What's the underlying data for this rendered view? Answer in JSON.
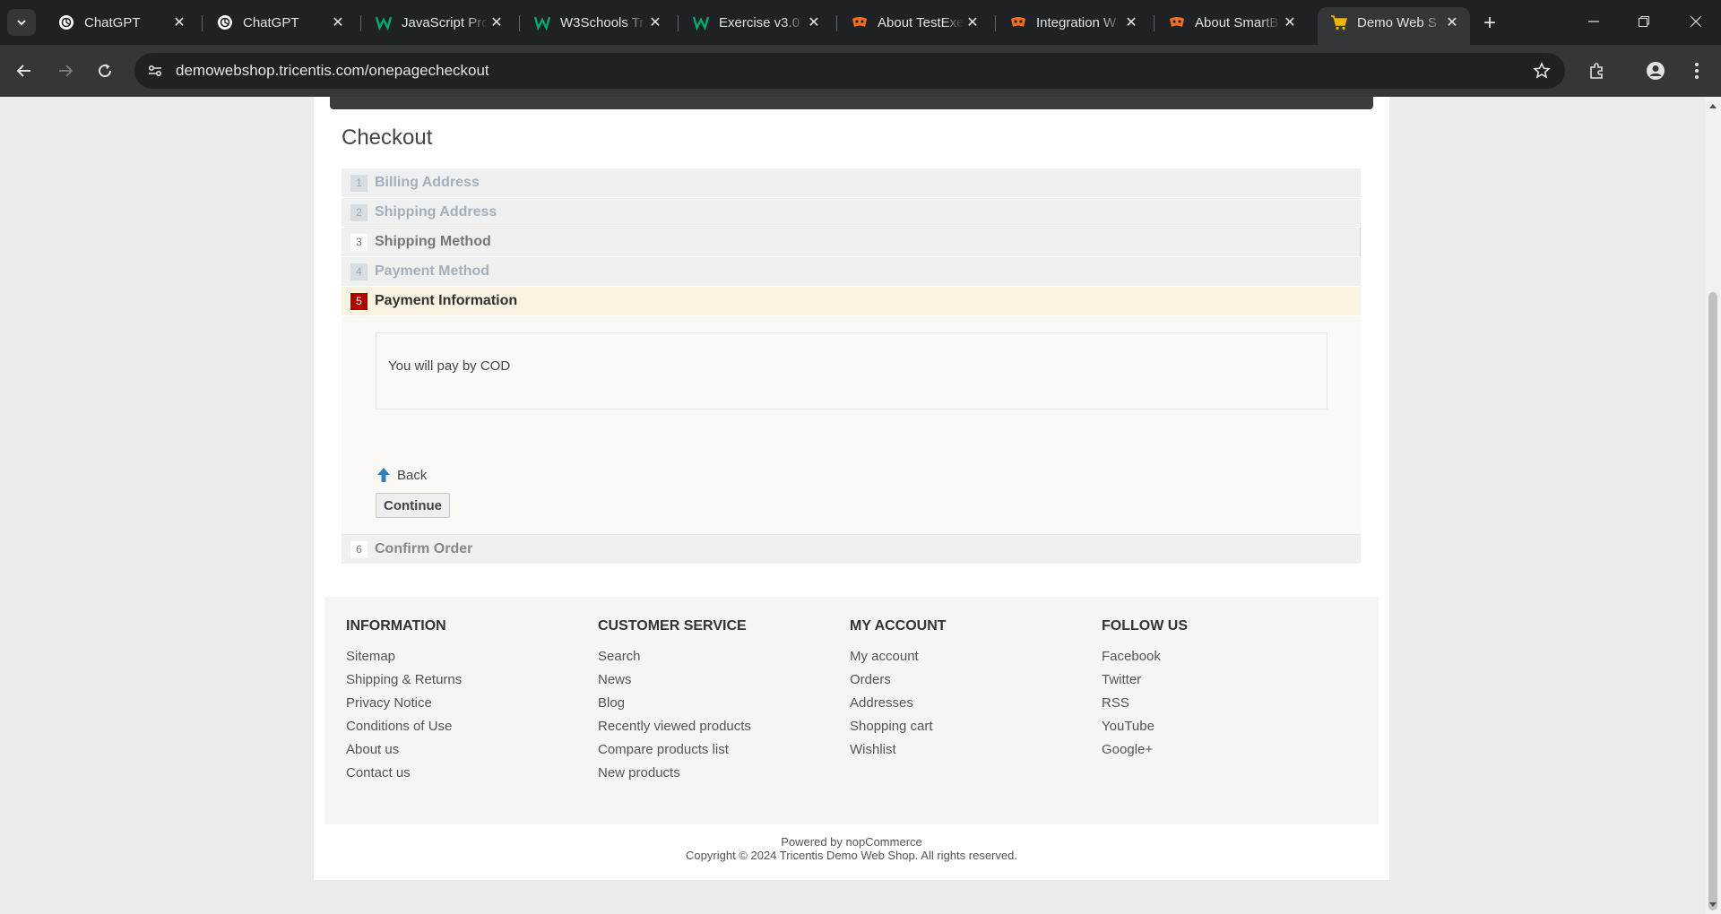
{
  "browser": {
    "tabs": [
      {
        "title": "ChatGPT",
        "icon": "chatgpt-icon"
      },
      {
        "title": "ChatGPT",
        "icon": "chatgpt-icon"
      },
      {
        "title": "JavaScript Pro",
        "icon": "w3schools-icon"
      },
      {
        "title": "W3Schools Tr",
        "icon": "w3schools-icon"
      },
      {
        "title": "Exercise v3.0",
        "icon": "w3schools-icon"
      },
      {
        "title": "About TestExe",
        "icon": "testexec-icon"
      },
      {
        "title": "Integration W",
        "icon": "testexec-icon"
      },
      {
        "title": "About SmartB",
        "icon": "testexec-icon"
      },
      {
        "title": "Demo Web S",
        "icon": "shopping-cart-icon",
        "active": true
      }
    ],
    "url": "demowebshop.tricentis.com/onepagecheckout"
  },
  "page": {
    "title": "Checkout",
    "steps": [
      {
        "number": "1",
        "label": "Billing Address",
        "state": "done"
      },
      {
        "number": "2",
        "label": "Shipping Address",
        "state": "done"
      },
      {
        "number": "3",
        "label": "Shipping Method",
        "state": "allowed"
      },
      {
        "number": "4",
        "label": "Payment Method",
        "state": "done"
      },
      {
        "number": "5",
        "label": "Payment Information",
        "state": "active"
      },
      {
        "number": "6",
        "label": "Confirm Order",
        "state": "pending"
      }
    ],
    "payment_info": {
      "text": "You will pay by COD",
      "back_label": "Back",
      "continue_label": "Continue"
    }
  },
  "footer": {
    "columns": [
      {
        "heading": "INFORMATION",
        "links": [
          "Sitemap",
          "Shipping & Returns",
          "Privacy Notice",
          "Conditions of Use",
          "About us",
          "Contact us"
        ]
      },
      {
        "heading": "CUSTOMER SERVICE",
        "links": [
          "Search",
          "News",
          "Blog",
          "Recently viewed products",
          "Compare products list",
          "New products"
        ]
      },
      {
        "heading": "MY ACCOUNT",
        "links": [
          "My account",
          "Orders",
          "Addresses",
          "Shopping cart",
          "Wishlist"
        ]
      },
      {
        "heading": "FOLLOW US",
        "links": [
          "Facebook",
          "Twitter",
          "RSS",
          "YouTube",
          "Google+"
        ]
      }
    ],
    "powered_by": "Powered by nopCommerce",
    "copyright": "Copyright © 2024 Tricentis Demo Web Shop. All rights reserved."
  },
  "colors": {
    "active_step_badge": "#b30000",
    "active_step_bg": "#fbf3e2",
    "chrome_dark": "#202124"
  }
}
